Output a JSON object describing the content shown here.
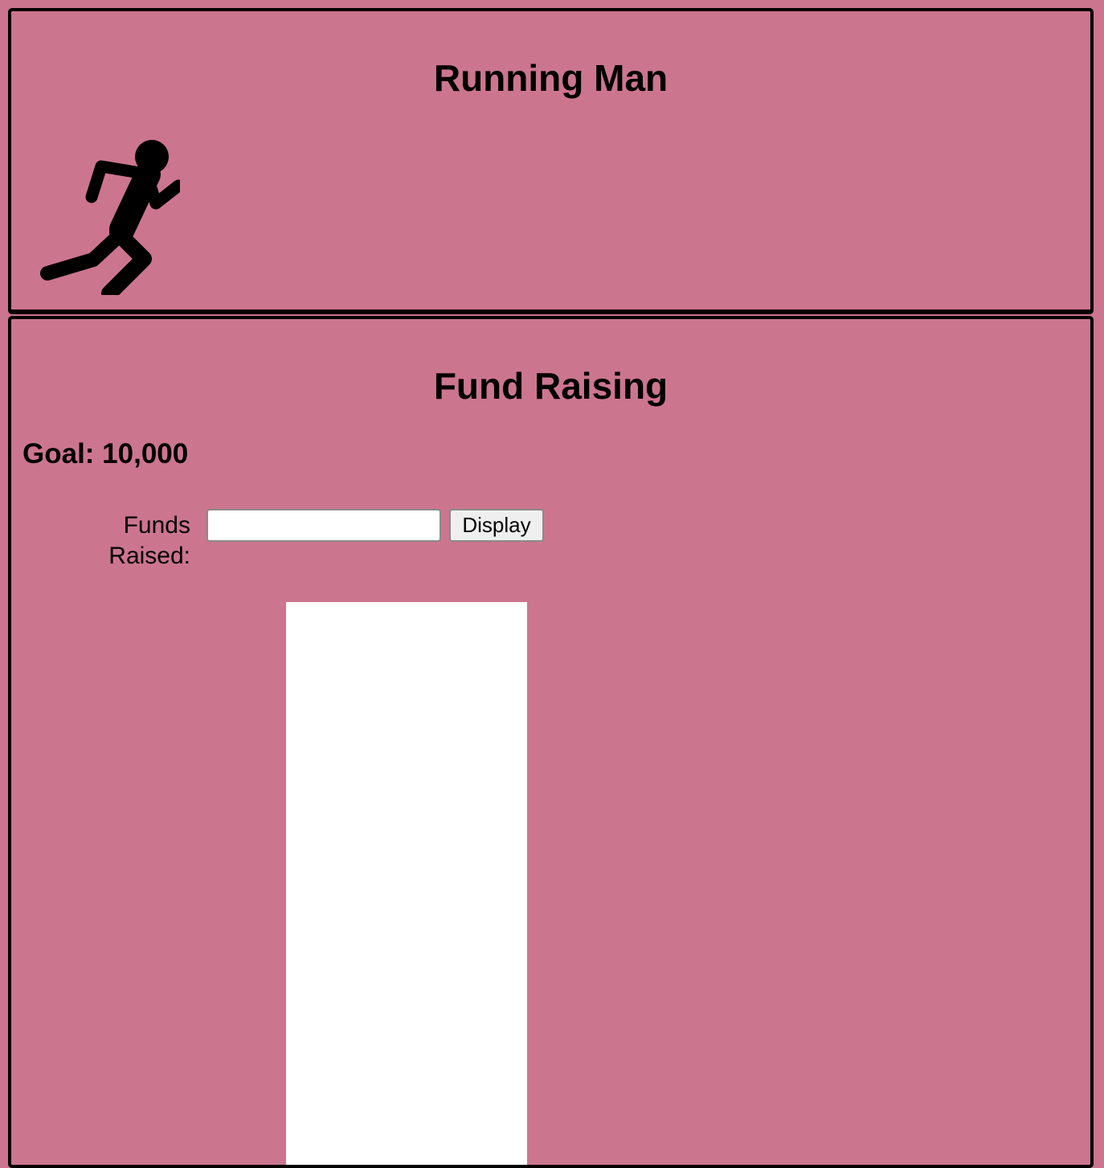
{
  "header": {
    "title": "Running Man",
    "icon": "running-man-icon"
  },
  "fundraising": {
    "title": "Fund Raising",
    "goal_text": "Goal: 10,000",
    "funds_label": "Funds Raised:",
    "funds_input_value": "",
    "funds_input_placeholder": "",
    "display_button_label": "Display",
    "progress_fraction": 0
  },
  "colors": {
    "background": "#cc758f",
    "border": "#000000",
    "thermometer_track": "#ffffff",
    "icon": "#000000"
  }
}
